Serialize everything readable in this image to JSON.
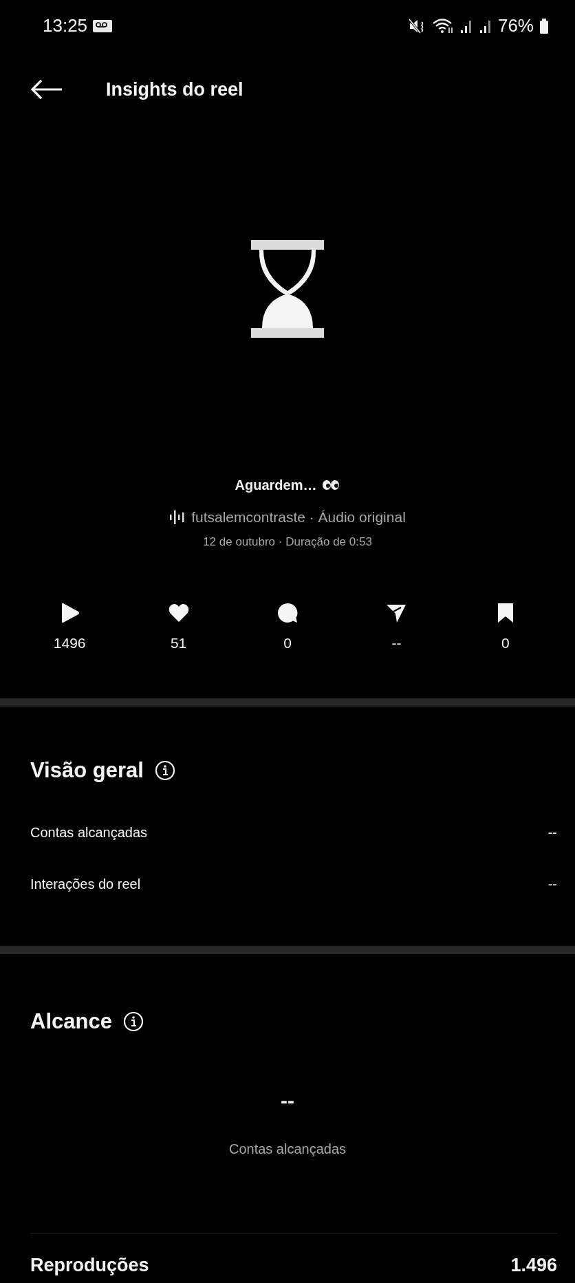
{
  "status_bar": {
    "time": "13:25",
    "battery": "76%"
  },
  "header": {
    "title": "Insights do reel"
  },
  "reel": {
    "caption": "Aguardem…",
    "audio": "futsalemcontraste · Áudio original",
    "meta": "12 de outubro · Duração de 0:53"
  },
  "stats": [
    {
      "kind": "plays",
      "value": "1496"
    },
    {
      "kind": "likes",
      "value": "51"
    },
    {
      "kind": "comments",
      "value": "0"
    },
    {
      "kind": "shares",
      "value": "--"
    },
    {
      "kind": "saves",
      "value": "0"
    }
  ],
  "overview": {
    "title": "Visão geral",
    "rows": [
      {
        "label": "Contas alcançadas",
        "value": "--"
      },
      {
        "label": "Interações do reel",
        "value": "--"
      }
    ]
  },
  "reach": {
    "title": "Alcance",
    "value": "--",
    "caption": "Contas alcançadas",
    "rows": [
      {
        "label": "Reproduções",
        "value": "1.496"
      }
    ]
  }
}
